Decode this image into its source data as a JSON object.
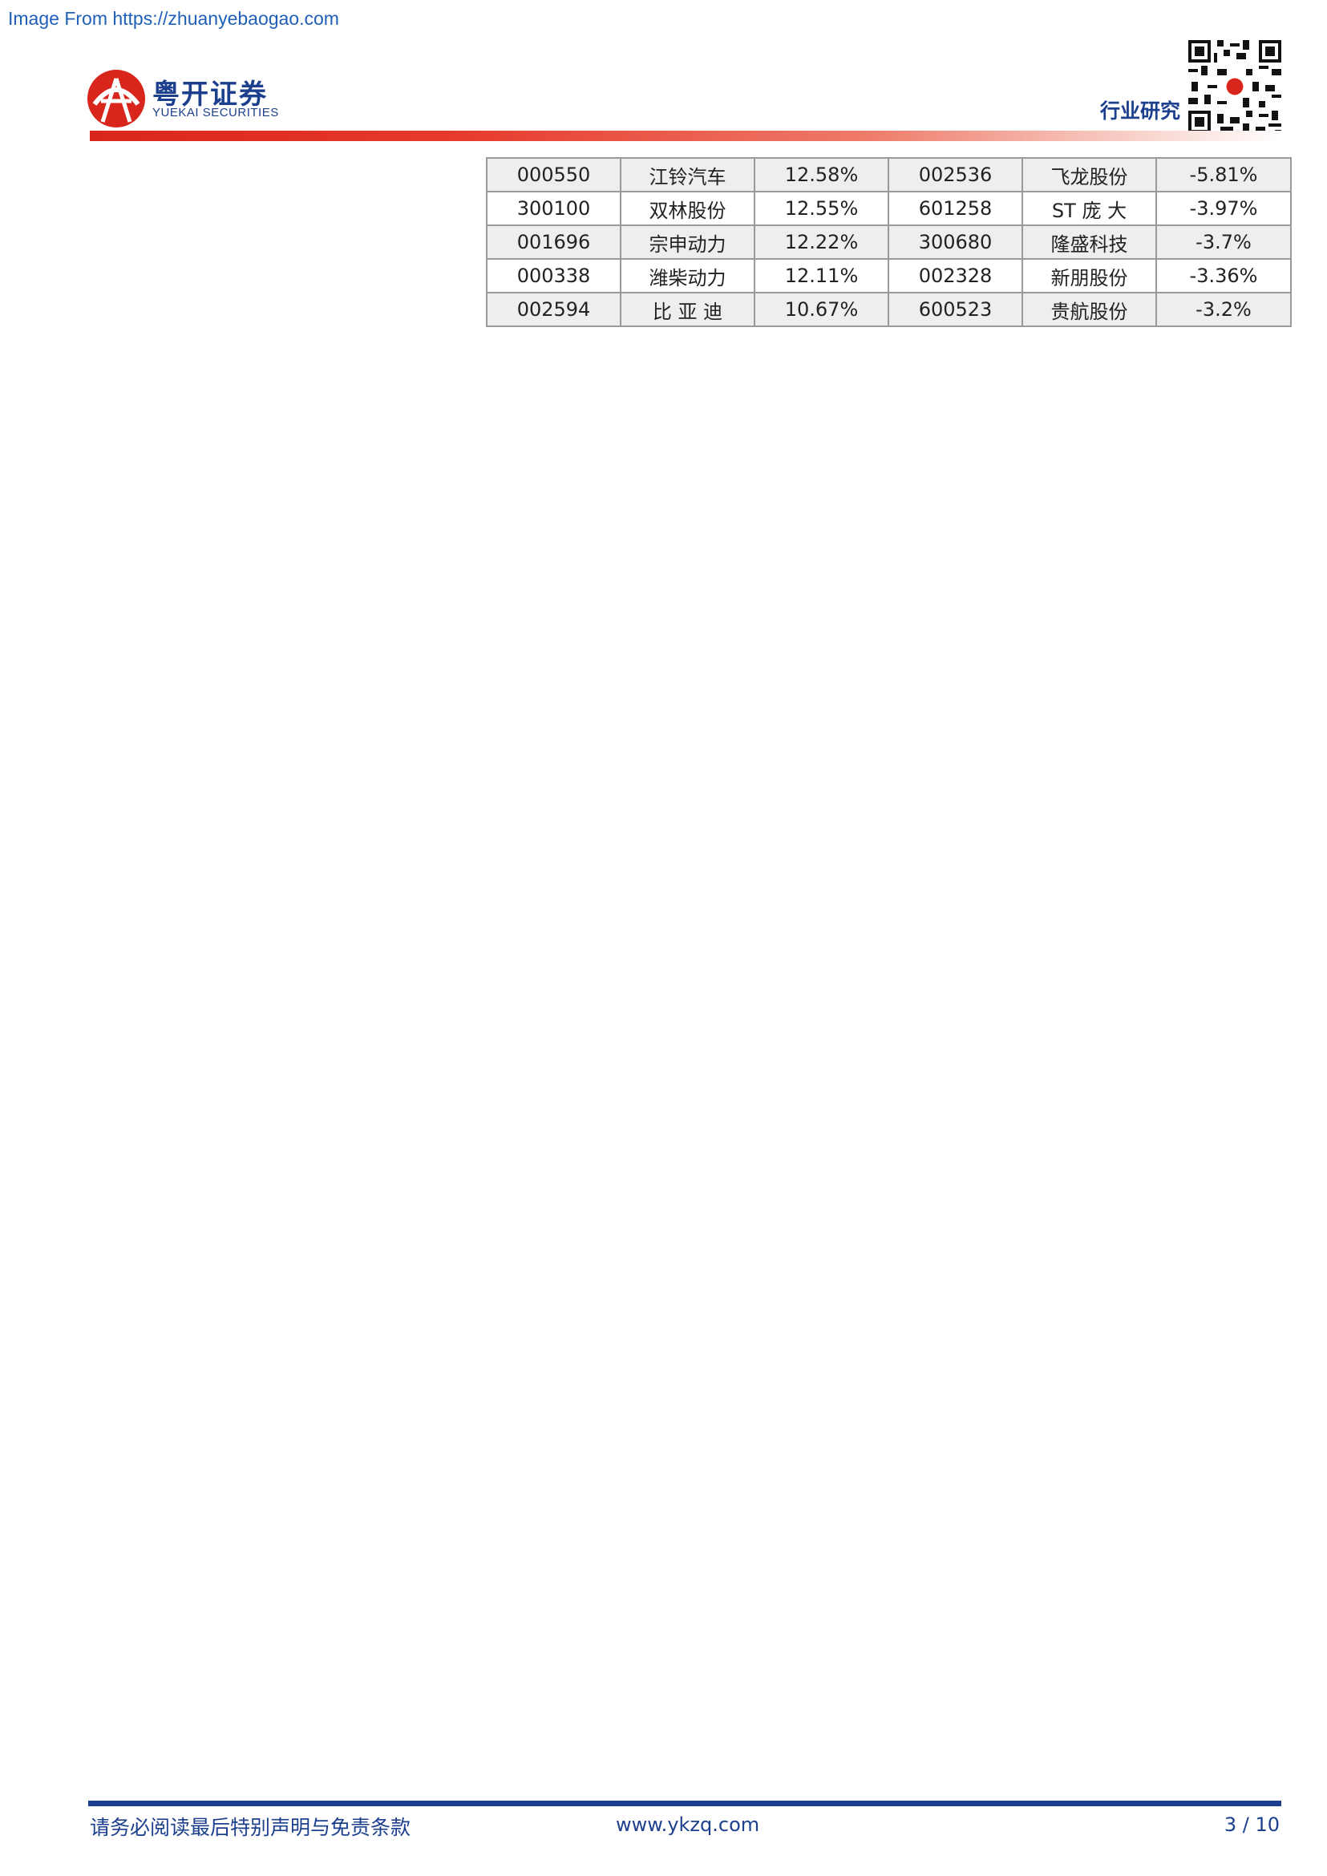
{
  "watermark": "Image From https://zhuanyebaogao.com",
  "header": {
    "logo_cn": "粤开证券",
    "logo_en": "YUEKAI SECURITIES",
    "tag": "行业研究",
    "colors": {
      "brand_blue": "#1c3f8e",
      "brand_red": "#d9261c"
    }
  },
  "table": {
    "rows": [
      [
        "000550",
        "江铃汽车",
        "12.58%",
        "002536",
        "飞龙股份",
        "-5.81%"
      ],
      [
        "300100",
        "双林股份",
        "12.55%",
        "601258",
        "ST 庞 大",
        "-3.97%"
      ],
      [
        "001696",
        "宗申动力",
        "12.22%",
        "300680",
        "隆盛科技",
        "-3.7%"
      ],
      [
        "000338",
        "潍柴动力",
        "12.11%",
        "002328",
        "新朋股份",
        "-3.36%"
      ],
      [
        "002594",
        "比 亚 迪",
        "10.67%",
        "600523",
        "贵航股份",
        "-3.2%"
      ]
    ]
  },
  "footer": {
    "disclaimer": "请务必阅读最后特别声明与免责条款",
    "website": "www.ykzq.com",
    "page": "3 / 10"
  }
}
